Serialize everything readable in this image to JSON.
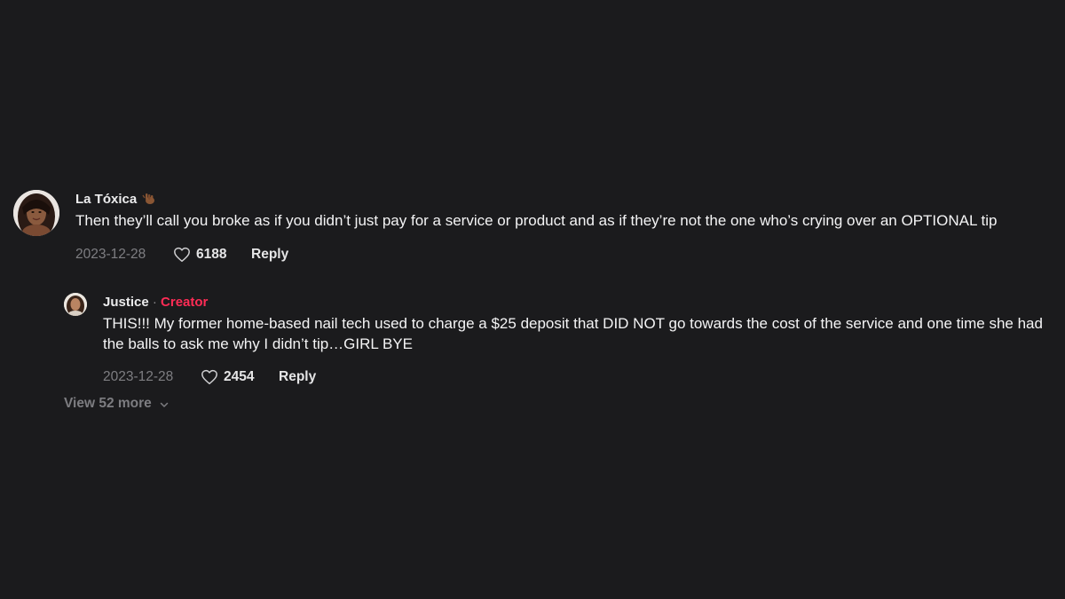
{
  "comments": [
    {
      "author": "La Tóxica",
      "author_badge_icon": "emoji-icon",
      "text": "Then they’ll call you broke as if you didn’t just pay for a service or product and as if they’re not the one who’s crying over an OPTIONAL tip",
      "date": "2023-12-28",
      "likes": "6188",
      "reply_label": "Reply"
    }
  ],
  "reply": {
    "author": "Justice",
    "separator": " · ",
    "role_label": "Creator",
    "text": "THIS!!! My former home-based nail tech used to charge a $25 deposit that DID NOT go towards the cost of the service and one time she had the balls to ask me why I didn’t tip…GIRL BYE",
    "date": "2023-12-28",
    "likes": "2454",
    "reply_label": "Reply"
  },
  "view_more": {
    "label": "View 52 more"
  },
  "colors": {
    "background": "#1b1b1d",
    "creator_accent": "#fe2c55",
    "muted_text": "#7e7e82"
  }
}
